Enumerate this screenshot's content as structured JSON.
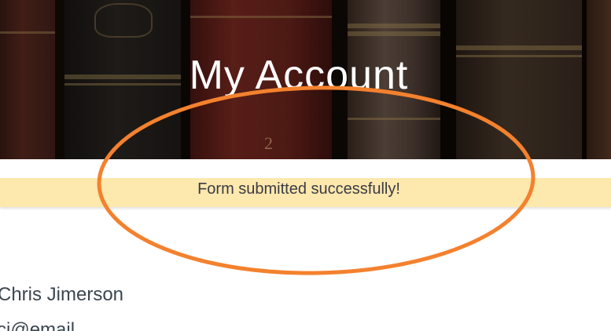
{
  "hero": {
    "title": "My Account",
    "spine_number": "2"
  },
  "notice": {
    "message": "Form submitted successfully!",
    "background": "#fde8ad"
  },
  "account": {
    "name": "Chris Jimerson",
    "email_partial": "ci@email"
  },
  "annotation": {
    "shape": "ellipse",
    "color": "#f4812e"
  }
}
